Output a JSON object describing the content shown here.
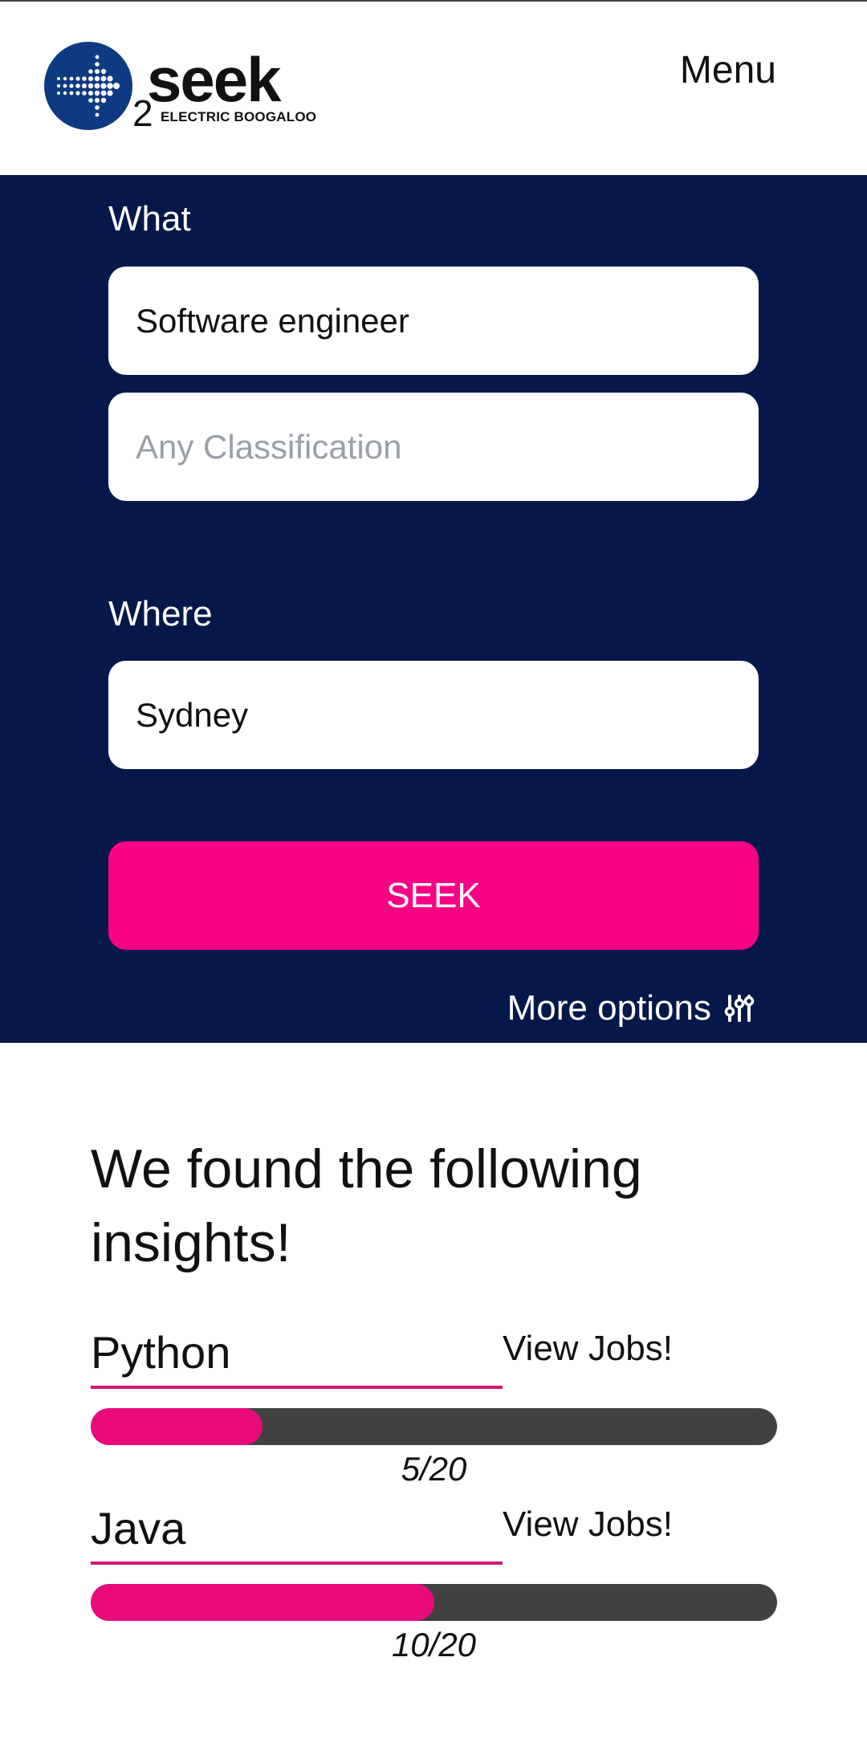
{
  "header": {
    "logo": {
      "sup": "2",
      "word": "seek",
      "tagline": "ELECTRIC BOOGALOO"
    },
    "menu_label": "Menu"
  },
  "search": {
    "what_label": "What",
    "keywords_value": "Software engineer",
    "classification_placeholder": "Any Classification",
    "where_label": "Where",
    "location_value": "Sydney",
    "seek_button": "SEEK",
    "more_options": "More options"
  },
  "insights": {
    "title": "We found the following insights!",
    "skills": [
      {
        "name": "Python",
        "link": "View Jobs!",
        "progress_text": "5/20",
        "progress": 0.25
      },
      {
        "name": "Java",
        "link": "View Jobs!",
        "progress_text": "10/20",
        "progress": 0.5
      }
    ]
  },
  "colors": {
    "panel": "#06184a",
    "accent": "#f90385",
    "bar_track": "#414141",
    "logo_circle": "#0e3a82"
  },
  "icons": {
    "logo": "dotted-arrow-logo-icon",
    "options": "sliders-icon"
  }
}
